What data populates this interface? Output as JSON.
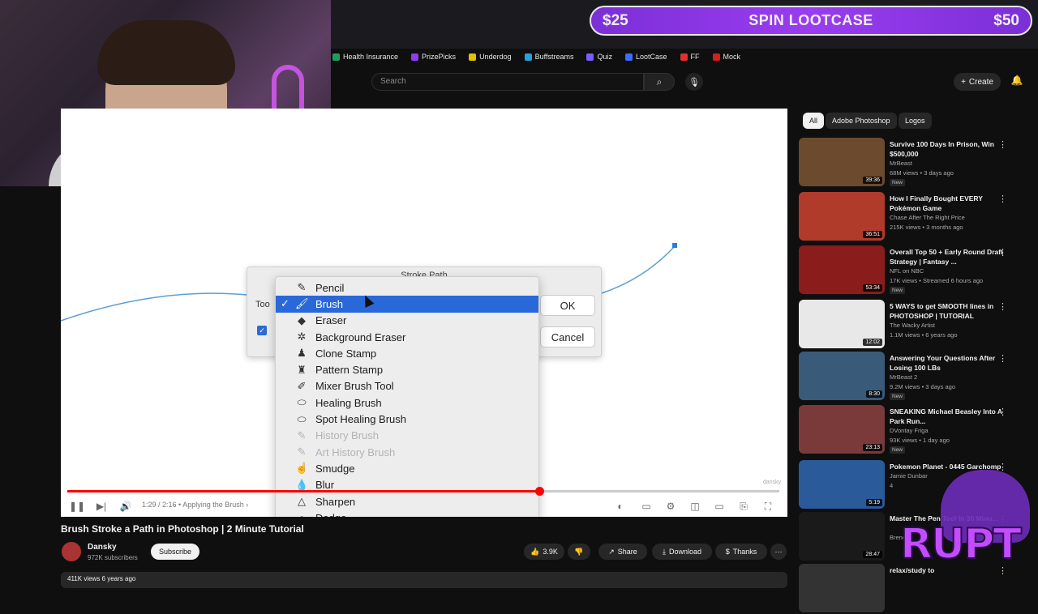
{
  "lootcase": {
    "left": "$25",
    "middle": "SPIN LOOTCASE",
    "right": "$50"
  },
  "bookmarks": [
    {
      "label": "Health Insurance",
      "color": "#1e9e5a"
    },
    {
      "label": "PrizePicks",
      "color": "#8d3cf0"
    },
    {
      "label": "Underdog",
      "color": "#e0c200"
    },
    {
      "label": "Buffstreams",
      "color": "#2aa0d8"
    },
    {
      "label": "Quiz",
      "color": "#7a5cff"
    },
    {
      "label": "LootCase",
      "color": "#3b6cff"
    },
    {
      "label": "FF",
      "color": "#e03030"
    },
    {
      "label": "Mock",
      "color": "#d02020"
    }
  ],
  "header": {
    "search_placeholder": "Search",
    "create_label": "Create"
  },
  "dialog": {
    "title": "Stroke Path",
    "tool_label": "Too",
    "ok": "OK",
    "cancel": "Cancel",
    "items": [
      {
        "label": "Pencil",
        "icon": "pencil-icon",
        "glyph": "✎",
        "selected": false,
        "disabled": false
      },
      {
        "label": "Brush",
        "icon": "brush-icon",
        "glyph": "🖌",
        "selected": true,
        "disabled": false
      },
      {
        "label": "Eraser",
        "icon": "eraser-icon",
        "glyph": "◆",
        "selected": false,
        "disabled": false
      },
      {
        "label": "Background Eraser",
        "icon": "background-eraser-icon",
        "glyph": "✲",
        "selected": false,
        "disabled": false
      },
      {
        "label": "Clone Stamp",
        "icon": "clone-stamp-icon",
        "glyph": "♟",
        "selected": false,
        "disabled": false
      },
      {
        "label": "Pattern Stamp",
        "icon": "pattern-stamp-icon",
        "glyph": "♜",
        "selected": false,
        "disabled": false
      },
      {
        "label": "Mixer Brush Tool",
        "icon": "mixer-brush-icon",
        "glyph": "✐",
        "selected": false,
        "disabled": false
      },
      {
        "label": "Healing Brush",
        "icon": "healing-brush-icon",
        "glyph": "⬭",
        "selected": false,
        "disabled": false
      },
      {
        "label": "Spot Healing Brush",
        "icon": "spot-healing-brush-icon",
        "glyph": "⬭",
        "selected": false,
        "disabled": false
      },
      {
        "label": "History Brush",
        "icon": "history-brush-icon",
        "glyph": "✎",
        "selected": false,
        "disabled": true
      },
      {
        "label": "Art History Brush",
        "icon": "art-history-brush-icon",
        "glyph": "✎",
        "selected": false,
        "disabled": true
      },
      {
        "label": "Smudge",
        "icon": "smudge-icon",
        "glyph": "☝",
        "selected": false,
        "disabled": false
      },
      {
        "label": "Blur",
        "icon": "blur-icon",
        "glyph": "💧",
        "selected": false,
        "disabled": false
      },
      {
        "label": "Sharpen",
        "icon": "sharpen-icon",
        "glyph": "△",
        "selected": false,
        "disabled": false
      },
      {
        "label": "Dodge",
        "icon": "dodge-icon",
        "glyph": "○",
        "selected": false,
        "disabled": false
      }
    ]
  },
  "player": {
    "time": "1:29 / 2:16",
    "chapter": "Applying the Brush",
    "progress": 0.663,
    "watermark": "dansky"
  },
  "video": {
    "title": "Brush Stroke a Path in Photoshop | 2 Minute Tutorial",
    "channel": "Dansky",
    "subscribers": "972K subscribers",
    "subscribe": "Subscribe",
    "likes": "3.9K",
    "share": "Share",
    "download": "Download",
    "thanks": "Thanks",
    "views_line": "411K views  6 years ago"
  },
  "chips": [
    "All",
    "Adobe Photoshop",
    "Logos"
  ],
  "recommendations": [
    {
      "title": "Survive 100 Days In Prison, Win $500,000",
      "channel": "MrBeast",
      "meta": "68M views • 3 days ago",
      "badge": "New",
      "duration": "39:36",
      "thumb": "#6b4a2e"
    },
    {
      "title": "How I Finally Bought EVERY Pokémon Game",
      "channel": "Chase After The Right Price",
      "meta": "215K views • 3 months ago",
      "badge": "",
      "duration": "36:51",
      "thumb": "#b03b2a"
    },
    {
      "title": "Overall Top 50 + Early Round Draft Strategy | Fantasy ...",
      "channel": "NFL on NBC",
      "meta": "17K views • Streamed 6 hours ago",
      "badge": "New",
      "duration": "53:34",
      "thumb": "#8a1c1c"
    },
    {
      "title": "5 WAYS to get SMOOTH lines in PHOTOSHOP | TUTORIAL",
      "channel": "The Wacky Artist",
      "meta": "1.1M views • 6 years ago",
      "badge": "",
      "duration": "12:02",
      "thumb": "#e8e8e8"
    },
    {
      "title": "Answering Your Questions After Losing 100 LBs",
      "channel": "MrBeast 2",
      "meta": "9.2M views • 3 days ago",
      "badge": "New",
      "duration": "8:30",
      "thumb": "#3a5a7a"
    },
    {
      "title": "SNEAKING Michael Beasley Into A Park Run...",
      "channel": "DVontay Friga",
      "meta": "93K views • 1 day ago",
      "badge": "New",
      "duration": "23:13",
      "thumb": "#7a3a3a"
    },
    {
      "title": "Pokemon Planet - 0445 Garchomp",
      "channel": "Jamie Dunbar",
      "meta": "4",
      "badge": "",
      "duration": "5:19",
      "thumb": "#2a5a9a"
    },
    {
      "title": "Master The Pen Tool In 30 Minu...",
      "channel": "Brend",
      "meta": "",
      "badge": "",
      "duration": "28:47",
      "thumb": "#1a1a1a"
    },
    {
      "title": "relax/study to",
      "channel": "",
      "meta": "",
      "badge": "",
      "duration": "",
      "thumb": "#333333"
    }
  ],
  "overlay": {
    "brand": "RUPT"
  }
}
